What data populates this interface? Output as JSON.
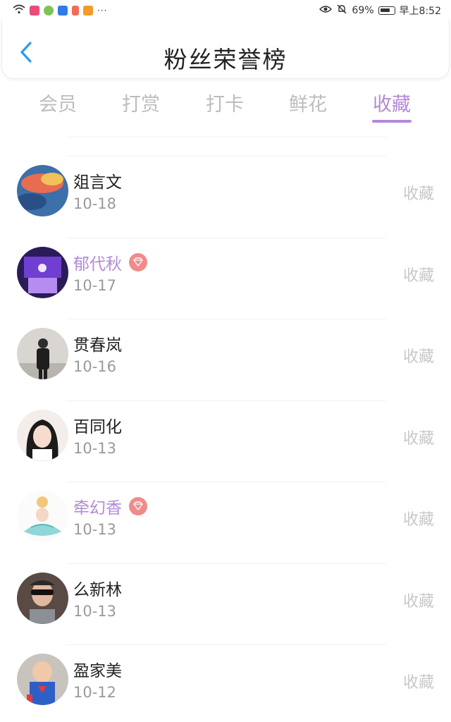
{
  "status_bar": {
    "battery": "69%",
    "time": "早上8:52",
    "dots": "···"
  },
  "header": {
    "title": "粉丝荣誉榜",
    "back_icon": "chevron-left-icon",
    "accent_color": "#2b9bee"
  },
  "tabs": [
    {
      "label": "会员",
      "active": false
    },
    {
      "label": "打赏",
      "active": false
    },
    {
      "label": "打卡",
      "active": false
    },
    {
      "label": "鲜花",
      "active": false
    },
    {
      "label": "收藏",
      "active": true
    }
  ],
  "colors": {
    "active_tab": "#b38ad6",
    "vip_name": "#b38ad6",
    "badge": "#f08b8b"
  },
  "fans": [
    {
      "name": "爼言文",
      "date": "10-18",
      "action": "收藏",
      "vip": false
    },
    {
      "name": "郁代秋",
      "date": "10-17",
      "action": "收藏",
      "vip": true
    },
    {
      "name": "贯春岚",
      "date": "10-16",
      "action": "收藏",
      "vip": false
    },
    {
      "name": "百同化",
      "date": "10-13",
      "action": "收藏",
      "vip": false
    },
    {
      "name": "牵幻香",
      "date": "10-13",
      "action": "收藏",
      "vip": true
    },
    {
      "name": "么新林",
      "date": "10-13",
      "action": "收藏",
      "vip": false
    },
    {
      "name": "盈家美",
      "date": "10-12",
      "action": "收藏",
      "vip": false
    }
  ]
}
